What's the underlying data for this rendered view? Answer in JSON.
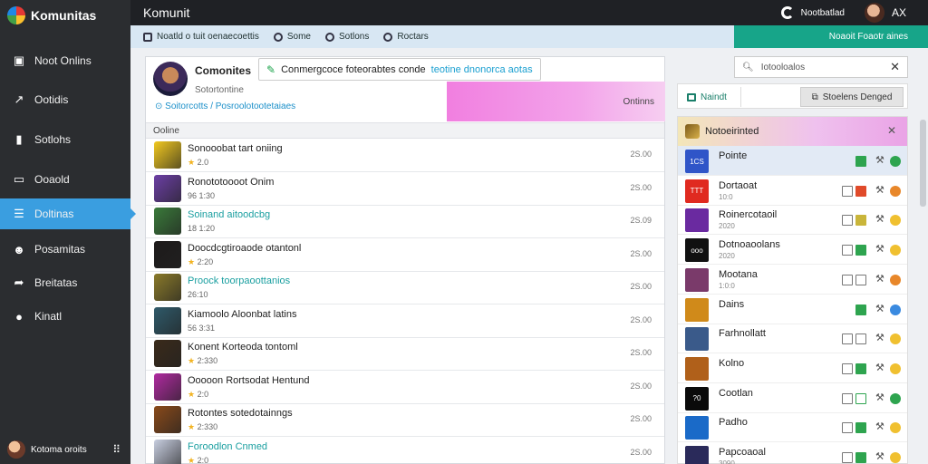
{
  "app": {
    "name": "Komunitas",
    "window_title": "Komunit"
  },
  "topbar": {
    "right_label": "Nootbatlad",
    "initials": "AX"
  },
  "sidebar": {
    "items": [
      {
        "label": "Noot Onlins",
        "icon": "square-list-icon"
      },
      {
        "label": "Ootidis",
        "icon": "trend-arrow-icon"
      },
      {
        "label": "Sotlohs",
        "icon": "bar-chart-icon"
      },
      {
        "label": "Ooaold",
        "icon": "folder-icon"
      },
      {
        "label": "Doltinas",
        "icon": "list-icon",
        "active": true
      },
      {
        "label": "Posamitas",
        "icon": "people-icon"
      },
      {
        "label": "Breitatas",
        "icon": "share-icon"
      },
      {
        "label": "Kinatl",
        "icon": "chat-icon"
      }
    ],
    "footer": {
      "label": "Kotoma oroits"
    }
  },
  "tabs": [
    {
      "label": "Noatld o tuit oenaecoettis",
      "icon": "square-icon"
    },
    {
      "label": "Some",
      "icon": "circle-icon"
    },
    {
      "label": "Sotlons",
      "icon": "circle-icon"
    },
    {
      "label": "Roctars",
      "icon": "circle-icon"
    }
  ],
  "tab_accent": {
    "label": "Noaoit Foaotr aines"
  },
  "profile": {
    "name": "Comonites",
    "status": "Sotortontine",
    "link": "Soitorcotts / Posroolotootetaiaes"
  },
  "compose": {
    "text": "Conmergcoce foteorabtes conde ",
    "highlight": "teotine dnonorca aotas"
  },
  "banner": {
    "label": "Ontinns"
  },
  "list_header": "Ooline",
  "games": [
    {
      "title": "Sonooobat tart oniing",
      "sub": "2.0",
      "star": true,
      "time": "2S.00",
      "teal": false,
      "thumb": "#f2c91f"
    },
    {
      "title": "Ronototoooot Onim",
      "sub": "96 1:30",
      "star": false,
      "time": "2S.00",
      "teal": false,
      "thumb": "#6c3fa5"
    },
    {
      "title": "Soinand aitoodcbg",
      "sub": "18 1:20",
      "star": false,
      "time": "2S.09",
      "teal": true,
      "thumb": "#3a7a3a"
    },
    {
      "title": "Doocdcgtiroaode otantonl",
      "sub": "2:20",
      "star": true,
      "time": "2S.00",
      "teal": false,
      "thumb": "#1d1a1a"
    },
    {
      "title": "Proock toorpaoottanios",
      "sub": "26:10",
      "star": false,
      "time": "2S.00",
      "teal": true,
      "thumb": "#8a7a2a"
    },
    {
      "title": "Kiamoolo Aloonbat latins",
      "sub": "56 3:31",
      "star": false,
      "time": "2S.00",
      "teal": false,
      "thumb": "#2f5a6a"
    },
    {
      "title": "Konent Korteoda tontoml",
      "sub": "2:330",
      "star": true,
      "time": "2S.00",
      "teal": false,
      "thumb": "#3a2a1a"
    },
    {
      "title": "Ooooon Rortsodat Hentund",
      "sub": "2:0",
      "star": true,
      "time": "2S.00",
      "teal": false,
      "thumb": "#b02aa0"
    },
    {
      "title": "Rotontes sotedotainngs",
      "sub": "2:330",
      "star": true,
      "time": "2S.00",
      "teal": false,
      "thumb": "#8a4a1a"
    },
    {
      "title": "Foroodlon Cnmed",
      "sub": "2:0",
      "star": true,
      "time": "2S.00",
      "teal": true,
      "thumb": "#c8cee0"
    }
  ],
  "right_search": {
    "placeholder": "Iotooloalos"
  },
  "right_toolbar": {
    "primary": "Naindt",
    "secondary": "Stoelens Denged"
  },
  "notifications": {
    "title": "Notoeirinted",
    "items": [
      {
        "name": "Pointe",
        "sub": "",
        "thumb": "#2f55c8",
        "thumb_label": "1CS",
        "box1": "none",
        "box2": "green",
        "dot": "#2ea44f",
        "hl": true
      },
      {
        "name": "Dortaoat",
        "sub": "10:0",
        "thumb": "#e02a20",
        "thumb_label": "TTT",
        "box1": "empty",
        "box2": "red",
        "dot": "#e8872a",
        "hl": false
      },
      {
        "name": "Roinercotaoil",
        "sub": "2020",
        "thumb": "#6a2aa0",
        "thumb_label": "",
        "box1": "empty",
        "box2": "yellow",
        "dot": "#f0c030",
        "hl": false
      },
      {
        "name": "Dotnoaoolans",
        "sub": "2020",
        "thumb": "#111111",
        "thumb_label": "ooo",
        "box1": "empty",
        "box2": "green",
        "dot": "#f0c030",
        "hl": false
      },
      {
        "name": "Mootana",
        "sub": "1:0:0",
        "thumb": "#7a3a6a",
        "thumb_label": "",
        "box1": "empty",
        "box2": "empty",
        "dot": "#e8872a",
        "hl": false
      },
      {
        "name": "Dains",
        "sub": "",
        "thumb": "#d08a1a",
        "thumb_label": "",
        "box1": "none",
        "box2": "green",
        "dot": "#3a8ae0",
        "hl": false
      },
      {
        "name": "Farhnollatt",
        "sub": "",
        "thumb": "#3a5a8a",
        "thumb_label": "",
        "box1": "empty",
        "box2": "empty",
        "dot": "#f0c030",
        "hl": false
      },
      {
        "name": "Kolno",
        "sub": "",
        "thumb": "#b0601a",
        "thumb_label": "",
        "box1": "empty",
        "box2": "green",
        "dot": "#f0c030",
        "hl": false
      },
      {
        "name": "Cootlan",
        "sub": "",
        "thumb": "#0a0a0a",
        "thumb_label": "?0",
        "box1": "empty",
        "box2": "gbox",
        "dot": "#2ea44f",
        "hl": false
      },
      {
        "name": "Padho",
        "sub": "",
        "thumb": "#1a6ac8",
        "thumb_label": "",
        "box1": "empty",
        "box2": "green",
        "dot": "#f0c030",
        "hl": false
      },
      {
        "name": "Papcoaoal",
        "sub": "3090",
        "thumb": "#2a2a5a",
        "thumb_label": "",
        "box1": "empty",
        "box2": "green",
        "dot": "#f0c030",
        "hl": false
      }
    ]
  },
  "colors": {
    "sidebar": "#2b2d30",
    "active": "#3a9ee0",
    "accent_green": "#17a589",
    "banner_pink": "#f17fe0"
  }
}
